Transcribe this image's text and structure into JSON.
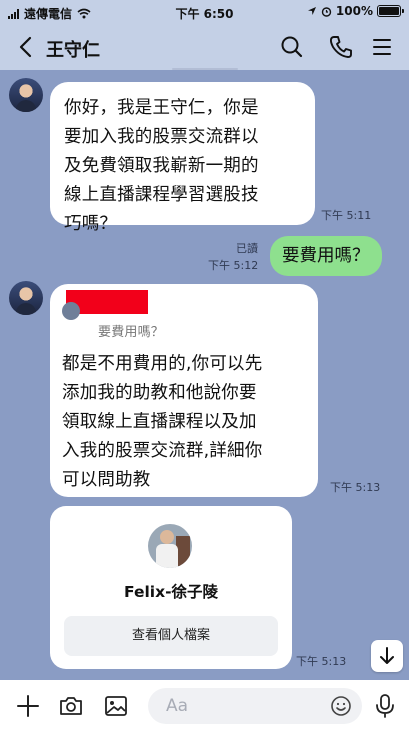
{
  "status_bar": {
    "carrier": "遠傳電信",
    "time": "下午 6:50",
    "battery": "100%",
    "battery_level": 1.0
  },
  "header": {
    "title": "王守仁",
    "icons": [
      "back-arrow-icon",
      "search-icon",
      "phone-icon",
      "menu-icon"
    ]
  },
  "messages": {
    "m1": {
      "lines": [
        "你好，我是王守仁，你是",
        "要加入我的股票交流群以",
        "及免費領取我嶄新一期的",
        "線上直播課程學習選股技",
        "巧嗎？"
      ],
      "time": "下午 5:11"
    },
    "m2": {
      "text": "要費用嗎？",
      "read": "已讀",
      "time": "下午 5:12"
    },
    "m3": {
      "quote": "要費用嗎？",
      "lines": [
        "都是不用費用的,你可以先",
        "添加我的助教和他說你要",
        "領取線上直播課程以及加",
        "入我的股票交流群,詳細你",
        "可以問助教"
      ],
      "time": "下午 5:13"
    },
    "m4": {
      "name": "Felix-徐子陵",
      "button": "查看個人檔案",
      "time": "下午 5:13"
    }
  },
  "input_bar": {
    "placeholder": "Aa",
    "icons": [
      "plus-icon",
      "camera-icon",
      "image-icon",
      "emoji-icon",
      "microphone-icon"
    ]
  },
  "colors": {
    "chat_background": "#8a9cc4",
    "header_background": "#c4d0e6",
    "sent_bubble": "#8ee08e",
    "received_bubble": "#ffffff",
    "redaction": "#f2001a"
  }
}
